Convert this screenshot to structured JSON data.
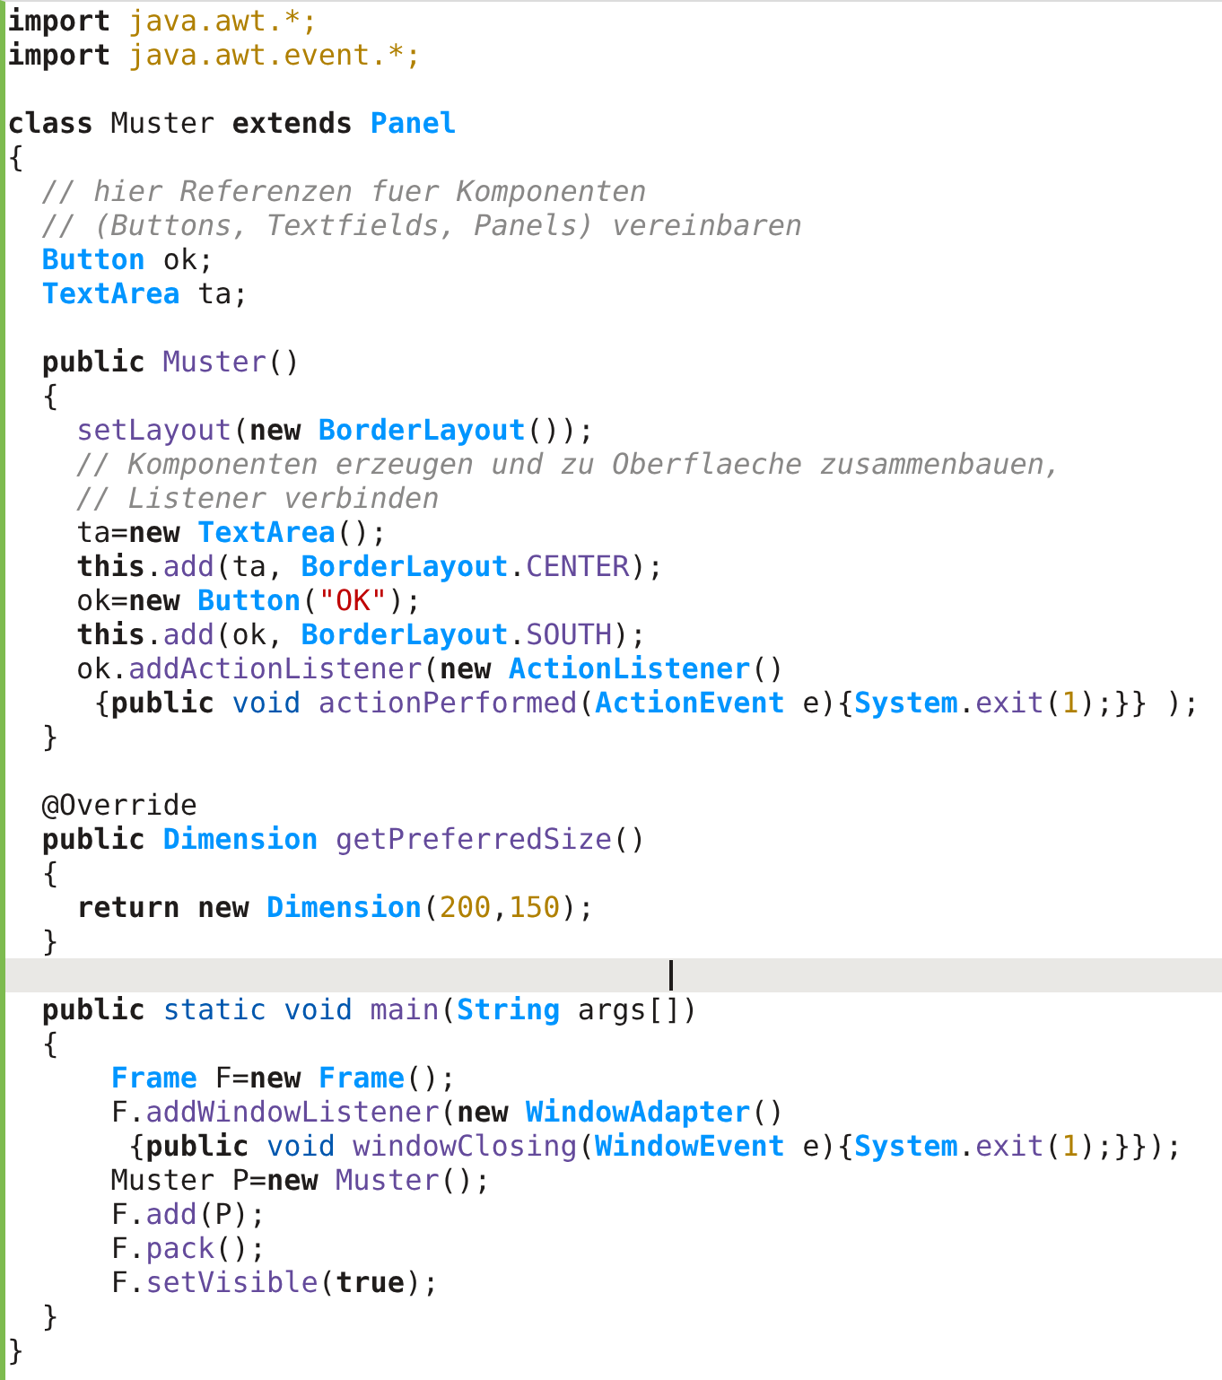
{
  "editor": {
    "lines": [
      {
        "current": false,
        "tokens": [
          {
            "kind": "keyword",
            "text": "import"
          },
          {
            "kind": "import",
            "text": " java.awt.*;"
          }
        ]
      },
      {
        "current": false,
        "tokens": [
          {
            "kind": "keyword",
            "text": "import"
          },
          {
            "kind": "import",
            "text": " java.awt.event.*;"
          }
        ]
      },
      {
        "current": false
      },
      {
        "current": false,
        "tokens": [
          {
            "kind": "keyword",
            "text": "class"
          },
          {
            "kind": "plain",
            "text": " Muster "
          },
          {
            "kind": "keyword",
            "text": "extends"
          },
          {
            "kind": "class",
            "text": " Panel"
          }
        ]
      },
      {
        "current": false,
        "tokens": [
          {
            "kind": "plain",
            "text": "{"
          }
        ]
      },
      {
        "current": false,
        "tokens": [
          {
            "kind": "comment",
            "text": "  // hier Referenzen fuer Komponenten"
          }
        ]
      },
      {
        "current": false,
        "tokens": [
          {
            "kind": "comment",
            "text": "  // (Buttons, Textfields, Panels) vereinbaren"
          }
        ]
      },
      {
        "current": false,
        "tokens": [
          {
            "kind": "class",
            "text": "  Button"
          },
          {
            "kind": "plain",
            "text": " ok;"
          }
        ]
      },
      {
        "current": false,
        "tokens": [
          {
            "kind": "class",
            "text": "  TextArea"
          },
          {
            "kind": "plain",
            "text": " ta;"
          }
        ]
      },
      {
        "current": false
      },
      {
        "current": false,
        "tokens": [
          {
            "kind": "keyword",
            "text": "  public"
          },
          {
            "kind": "function",
            "text": " Muster"
          },
          {
            "kind": "plain",
            "text": "()"
          }
        ]
      },
      {
        "current": false,
        "tokens": [
          {
            "kind": "plain",
            "text": "  {"
          }
        ]
      },
      {
        "current": false,
        "tokens": [
          {
            "kind": "function",
            "text": "    setLayout"
          },
          {
            "kind": "plain",
            "text": "("
          },
          {
            "kind": "keyword",
            "text": "new"
          },
          {
            "kind": "class",
            "text": " BorderLayout"
          },
          {
            "kind": "plain",
            "text": "());"
          }
        ]
      },
      {
        "current": false,
        "tokens": [
          {
            "kind": "comment",
            "text": "    // Komponenten erzeugen und zu Oberflaeche zusammenbauen,"
          }
        ]
      },
      {
        "current": false,
        "tokens": [
          {
            "kind": "comment",
            "text": "    // Listener verbinden"
          }
        ]
      },
      {
        "current": false,
        "tokens": [
          {
            "kind": "plain",
            "text": "    ta="
          },
          {
            "kind": "keyword",
            "text": "new"
          },
          {
            "kind": "class",
            "text": " TextArea"
          },
          {
            "kind": "plain",
            "text": "();"
          }
        ]
      },
      {
        "current": false,
        "tokens": [
          {
            "kind": "keyword",
            "text": "    this"
          },
          {
            "kind": "plain",
            "text": "."
          },
          {
            "kind": "function",
            "text": "add"
          },
          {
            "kind": "plain",
            "text": "(ta, "
          },
          {
            "kind": "class",
            "text": "BorderLayout"
          },
          {
            "kind": "plain",
            "text": "."
          },
          {
            "kind": "function",
            "text": "CENTER"
          },
          {
            "kind": "plain",
            "text": ");"
          }
        ]
      },
      {
        "current": false,
        "tokens": [
          {
            "kind": "plain",
            "text": "    ok="
          },
          {
            "kind": "keyword",
            "text": "new"
          },
          {
            "kind": "class",
            "text": " Button"
          },
          {
            "kind": "plain",
            "text": "("
          },
          {
            "kind": "string",
            "text": "\"OK\""
          },
          {
            "kind": "plain",
            "text": ");"
          }
        ]
      },
      {
        "current": false,
        "tokens": [
          {
            "kind": "keyword",
            "text": "    this"
          },
          {
            "kind": "plain",
            "text": "."
          },
          {
            "kind": "function",
            "text": "add"
          },
          {
            "kind": "plain",
            "text": "(ok, "
          },
          {
            "kind": "class",
            "text": "BorderLayout"
          },
          {
            "kind": "plain",
            "text": "."
          },
          {
            "kind": "function",
            "text": "SOUTH"
          },
          {
            "kind": "plain",
            "text": ");"
          }
        ]
      },
      {
        "current": false,
        "tokens": [
          {
            "kind": "plain",
            "text": "    ok."
          },
          {
            "kind": "function",
            "text": "addActionListener"
          },
          {
            "kind": "plain",
            "text": "("
          },
          {
            "kind": "keyword",
            "text": "new"
          },
          {
            "kind": "class",
            "text": " ActionListener"
          },
          {
            "kind": "plain",
            "text": "()"
          }
        ]
      },
      {
        "current": false,
        "tokens": [
          {
            "kind": "plain",
            "text": "     {"
          },
          {
            "kind": "keyword",
            "text": "public"
          },
          {
            "kind": "datatype",
            "text": " void"
          },
          {
            "kind": "function",
            "text": " actionPerformed"
          },
          {
            "kind": "plain",
            "text": "("
          },
          {
            "kind": "class",
            "text": "ActionEvent"
          },
          {
            "kind": "plain",
            "text": " e){"
          },
          {
            "kind": "class",
            "text": "System"
          },
          {
            "kind": "plain",
            "text": "."
          },
          {
            "kind": "function",
            "text": "exit"
          },
          {
            "kind": "plain",
            "text": "("
          },
          {
            "kind": "number",
            "text": "1"
          },
          {
            "kind": "plain",
            "text": ");}} );"
          }
        ]
      },
      {
        "current": false,
        "tokens": [
          {
            "kind": "plain",
            "text": "  }"
          }
        ]
      },
      {
        "current": false
      },
      {
        "current": false,
        "tokens": [
          {
            "kind": "plain",
            "text": "  @Override"
          }
        ]
      },
      {
        "current": false,
        "tokens": [
          {
            "kind": "keyword",
            "text": "  public"
          },
          {
            "kind": "class",
            "text": " Dimension"
          },
          {
            "kind": "function",
            "text": " getPreferredSize"
          },
          {
            "kind": "plain",
            "text": "()"
          }
        ]
      },
      {
        "current": false,
        "tokens": [
          {
            "kind": "plain",
            "text": "  {"
          }
        ]
      },
      {
        "current": false,
        "tokens": [
          {
            "kind": "keyword",
            "text": "    return new"
          },
          {
            "kind": "class",
            "text": " Dimension"
          },
          {
            "kind": "plain",
            "text": "("
          },
          {
            "kind": "number",
            "text": "200"
          },
          {
            "kind": "plain",
            "text": ","
          },
          {
            "kind": "number",
            "text": "150"
          },
          {
            "kind": "plain",
            "text": ");"
          }
        ]
      },
      {
        "current": false,
        "tokens": [
          {
            "kind": "plain",
            "text": "  }"
          }
        ]
      },
      {
        "current": true
      },
      {
        "current": false,
        "tokens": [
          {
            "kind": "keyword",
            "text": "  public"
          },
          {
            "kind": "datatype",
            "text": " static void"
          },
          {
            "kind": "function",
            "text": " main"
          },
          {
            "kind": "plain",
            "text": "("
          },
          {
            "kind": "class",
            "text": "String"
          },
          {
            "kind": "plain",
            "text": " args[])"
          }
        ]
      },
      {
        "current": false,
        "tokens": [
          {
            "kind": "plain",
            "text": "  {"
          }
        ]
      },
      {
        "current": false,
        "tokens": [
          {
            "kind": "class",
            "text": "      Frame"
          },
          {
            "kind": "plain",
            "text": " F="
          },
          {
            "kind": "keyword",
            "text": "new"
          },
          {
            "kind": "class",
            "text": " Frame"
          },
          {
            "kind": "plain",
            "text": "();"
          }
        ]
      },
      {
        "current": false,
        "tokens": [
          {
            "kind": "plain",
            "text": "      F."
          },
          {
            "kind": "function",
            "text": "addWindowListener"
          },
          {
            "kind": "plain",
            "text": "("
          },
          {
            "kind": "keyword",
            "text": "new"
          },
          {
            "kind": "class",
            "text": " WindowAdapter"
          },
          {
            "kind": "plain",
            "text": "()"
          }
        ]
      },
      {
        "current": false,
        "tokens": [
          {
            "kind": "plain",
            "text": "       {"
          },
          {
            "kind": "keyword",
            "text": "public"
          },
          {
            "kind": "datatype",
            "text": " void"
          },
          {
            "kind": "function",
            "text": " windowClosing"
          },
          {
            "kind": "plain",
            "text": "("
          },
          {
            "kind": "class",
            "text": "WindowEvent"
          },
          {
            "kind": "plain",
            "text": " e){"
          },
          {
            "kind": "class",
            "text": "System"
          },
          {
            "kind": "plain",
            "text": "."
          },
          {
            "kind": "function",
            "text": "exit"
          },
          {
            "kind": "plain",
            "text": "("
          },
          {
            "kind": "number",
            "text": "1"
          },
          {
            "kind": "plain",
            "text": ");}});"
          }
        ]
      },
      {
        "current": false,
        "tokens": [
          {
            "kind": "plain",
            "text": "      Muster P="
          },
          {
            "kind": "keyword",
            "text": "new"
          },
          {
            "kind": "function",
            "text": " Muster"
          },
          {
            "kind": "plain",
            "text": "();"
          }
        ]
      },
      {
        "current": false,
        "tokens": [
          {
            "kind": "plain",
            "text": "      F."
          },
          {
            "kind": "function",
            "text": "add"
          },
          {
            "kind": "plain",
            "text": "(P);"
          }
        ]
      },
      {
        "current": false,
        "tokens": [
          {
            "kind": "plain",
            "text": "      F."
          },
          {
            "kind": "function",
            "text": "pack"
          },
          {
            "kind": "plain",
            "text": "();"
          }
        ]
      },
      {
        "current": false,
        "tokens": [
          {
            "kind": "plain",
            "text": "      F."
          },
          {
            "kind": "function",
            "text": "setVisible"
          },
          {
            "kind": "plain",
            "text": "("
          },
          {
            "kind": "keyword",
            "text": "true"
          },
          {
            "kind": "plain",
            "text": ");"
          }
        ]
      },
      {
        "current": false,
        "tokens": [
          {
            "kind": "plain",
            "text": "  }"
          }
        ]
      },
      {
        "current": false,
        "tokens": [
          {
            "kind": "plain",
            "text": "}"
          }
        ]
      }
    ]
  }
}
